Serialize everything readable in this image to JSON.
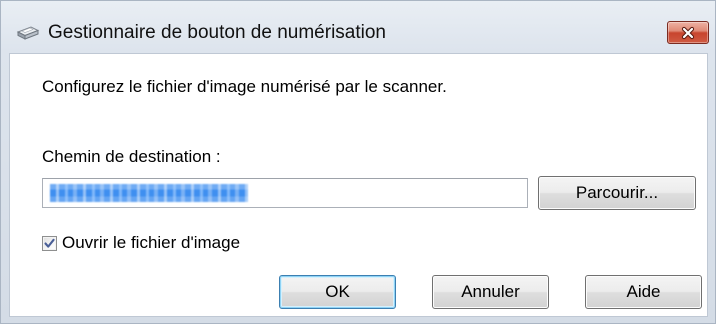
{
  "window": {
    "title": "Gestionnaire de bouton de numérisation",
    "icon": "scanner-icon",
    "close_icon": "close-icon"
  },
  "dialog": {
    "description": "Configurez le fichier d'image numérisé par le scanner.",
    "destination_label": "Chemin de destination :",
    "browse_label": "Parcourir...",
    "open_image": {
      "label": "Ouvrir le fichier d'image",
      "checked": true,
      "icon": "checkmark-icon"
    },
    "buttons": [
      {
        "label": "OK",
        "default": true
      },
      {
        "label": "Annuler",
        "default": false
      },
      {
        "label": "Aide",
        "default": false
      }
    ]
  },
  "colors": {
    "title_bar": "#dde4ed",
    "client_background": "#ffffff",
    "close_button": "#c8452e",
    "selection": "#3f8ff0",
    "default_button_border": "#3c7fb1",
    "checkmark": "#4a5f97"
  }
}
